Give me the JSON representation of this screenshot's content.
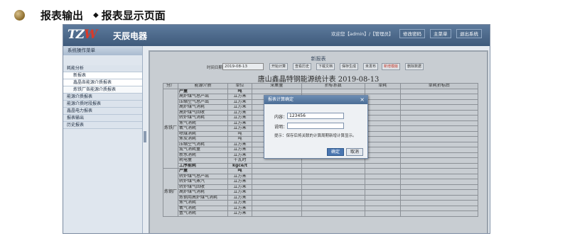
{
  "slide": {
    "title": "报表输出",
    "subtitle": "报表显示页面"
  },
  "app": {
    "logo_text": "TZW",
    "brand": "天辰电器",
    "user_info": "欢迎您【admin】/【管理员】",
    "top_buttons": [
      "修改密码",
      "主菜单",
      "退出系统"
    ]
  },
  "sidebar": {
    "header": "系统操作菜单",
    "items": [
      {
        "label": "耗能分析",
        "level": "group"
      },
      {
        "label": "新报表",
        "level": "sub"
      },
      {
        "label": "鑫晶各能源介质报表",
        "level": "sub"
      },
      {
        "label": "炼铁厂各能源介质报表",
        "level": "sub2"
      },
      {
        "label": "能源介质报表",
        "level": "group"
      },
      {
        "label": "能源介质时段报表",
        "level": "group"
      },
      {
        "label": "鑫晶电力报表",
        "level": "group"
      },
      {
        "label": "报表输出",
        "level": "group"
      },
      {
        "label": "历史报表",
        "level": "group"
      }
    ]
  },
  "report": {
    "title": "新报表",
    "date_label": "时间日期：",
    "date_value": "2019-08-13",
    "toolbar_buttons": [
      "开始计算",
      "查看历史",
      "下载文档",
      "保存生成",
      "未发布",
      "新增模版",
      "删除数据"
    ],
    "sheet_title": "唐山鑫晶特钢能源统计表 2019-08-13",
    "columns": [
      "分厂",
      "能源介质",
      "单位",
      "采集量",
      "折标系数",
      "单耗",
      "单耗折标后"
    ],
    "factory_1": "炼铁厂",
    "factory_2": "炼钢厂",
    "rows": [
      {
        "name": "产量",
        "unit": "吨",
        "bold": true
      },
      {
        "name": "高炉煤气总产出",
        "unit": "立方米"
      },
      {
        "name": "压缩空气总产出",
        "unit": "立方米"
      },
      {
        "name": "高炉煤气消耗",
        "unit": "立方米"
      },
      {
        "name": "高炉煤气回收",
        "unit": "立方米"
      },
      {
        "name": "转炉煤气消耗",
        "unit": "立方米"
      },
      {
        "name": "焦气消耗",
        "unit": "立方米"
      },
      {
        "name": "氧气消耗",
        "unit": "立方米"
      },
      {
        "name": "喷煤消耗",
        "unit": "吨"
      },
      {
        "name": "焦炭消耗",
        "unit": "吨"
      },
      {
        "name": "压缩空气消耗",
        "unit": "立方米"
      },
      {
        "name": "氮气消耗量",
        "unit": "立方米"
      },
      {
        "name": "新水消耗",
        "unit": "立方米"
      },
      {
        "name": "耗电量",
        "unit": "千瓦时"
      },
      {
        "name": "工序能耗",
        "unit": "kgce/t",
        "bold": true
      },
      {
        "name": "产量",
        "unit": "吨",
        "bold": true
      },
      {
        "name": "转炉煤气总产出",
        "unit": "立方米"
      },
      {
        "name": "转炉煤气蒸汽",
        "unit": "立方米"
      },
      {
        "name": "转炉煤气回收",
        "unit": "立方米"
      },
      {
        "name": "高炉煤气消耗",
        "unit": "立方米"
      },
      {
        "name": "炼钢用高炉煤气消耗",
        "unit": "立方米"
      },
      {
        "name": "焦气消耗",
        "unit": "立方米"
      },
      {
        "name": "氧气消耗",
        "unit": "立方米"
      },
      {
        "name": "氩气消耗",
        "unit": "立方米"
      }
    ]
  },
  "dialog": {
    "title": "报表计算确定",
    "content_label": "内容：",
    "content_value": "123456",
    "note_label": "说明：",
    "note_value": "",
    "hint": "提示：保存后将关联的计算周期新增计算显示。",
    "ok_label": "确定",
    "cancel_label": "取消"
  }
}
